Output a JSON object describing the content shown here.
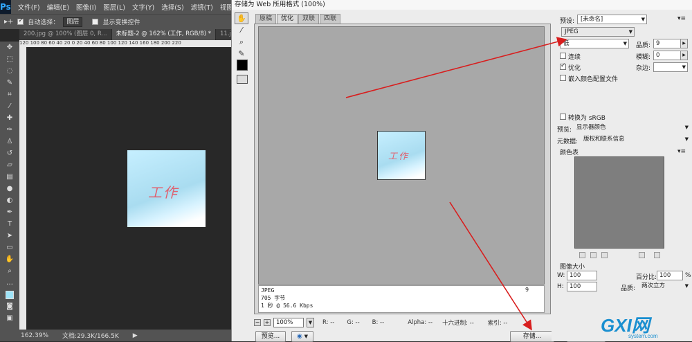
{
  "ps": {
    "logo": "Ps",
    "menu": [
      "文件(F)",
      "编辑(E)",
      "图像(I)",
      "图层(L)",
      "文字(Y)",
      "选择(S)",
      "滤镜(T)",
      "视图(V)"
    ],
    "options": {
      "move_tool": "▸+",
      "auto_select_label": "自动选择：",
      "auto_select_value": "图层",
      "show_transform_label": "显示变换控件"
    },
    "tabs": [
      "200.jpg @ 100% (图层 0, R...",
      "未标题-2 @ 162% (工作, RGB/8) *",
      "11.jpg"
    ],
    "ruler_h": "120  100  80  60  40  20  0  20  40  60  80  100  120  140  160  180  200  220",
    "status": {
      "zoom": "162.39%",
      "doc": "文档:29.3K/166.5K"
    },
    "doc_text": "工作"
  },
  "dialog": {
    "title": "存储为 Web 所用格式 (100%)",
    "view_tabs": [
      "原稿",
      "优化",
      "双联",
      "四联"
    ],
    "info": {
      "format": "JPEG",
      "size": "705 字节",
      "speed": "1 秒 @ 56.6 Kbps",
      "page_num": "9"
    },
    "image_text": "工作",
    "bottom": {
      "zoom": "100%",
      "r": "R: --",
      "g": "G: --",
      "b": "B: --",
      "alpha": "Alpha: --",
      "hex": "十六进制: --",
      "index": "索引: --"
    },
    "buttons": {
      "preview": "预览...",
      "save": "存储...",
      "reset": "复位"
    },
    "panel": {
      "preset_label": "预设:",
      "preset_value": "[未命名]",
      "format_value": "JPEG",
      "quality_level": "低",
      "quality_label": "品质:",
      "quality_value": "9",
      "progressive_label": "连续",
      "blur_label": "模糊:",
      "blur_value": "0",
      "optimized_label": "优化",
      "matte_label": "杂边:",
      "embed_profile_label": "嵌入颜色配置文件",
      "convert_srgb_label": "转换为 sRGB",
      "preview_label": "预览:",
      "preview_value": "显示器颜色",
      "metadata_label": "元数据:",
      "metadata_value": "版权和联系信息",
      "color_table_label": "颜色表",
      "image_size_label": "图像大小",
      "w_label": "W:",
      "w_value": "100",
      "percent_label": "百分比:",
      "percent_value": "100",
      "percent_unit": "%",
      "h_label": "H:",
      "h_value": "100",
      "quality_resample_label": "品质:",
      "quality_resample_value": "两次立方"
    }
  },
  "watermark": {
    "logo": "GXI网",
    "domain": "system.com"
  },
  "colors": {
    "ps_bg": "#282828",
    "ps_panel": "#535353",
    "dialog_bg": "#ececec",
    "preview_bg": "#a8a8a8",
    "arrow": "#d81e1e",
    "doc_text": "#e0616f"
  }
}
